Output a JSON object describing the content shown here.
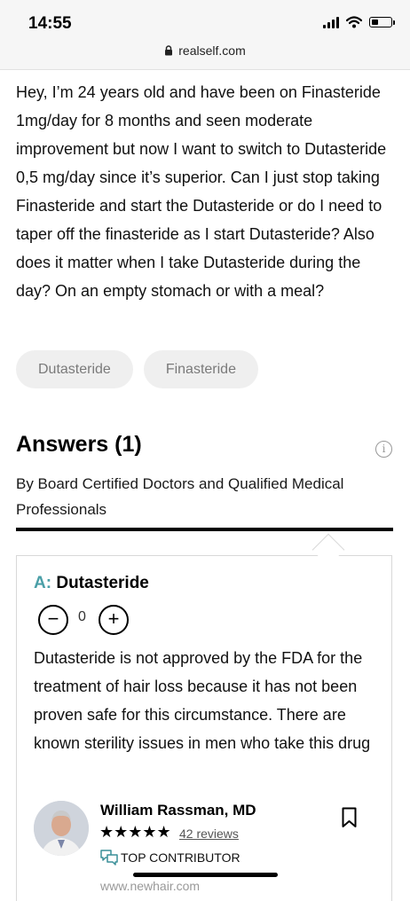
{
  "status_bar": {
    "time": "14:55",
    "battery_level_percent": 30
  },
  "browser": {
    "domain": "realself.com"
  },
  "question": {
    "body": "Hey, I’m 24 years old and have been on Finasteride 1mg/day for 8 months and seen moderate improvement but now I want to switch to Dutasteride 0,5 mg/day since it’s superior. Can I just stop taking Finasteride and start the Dutasteride or do I need to taper off the finasteride as I start Dutasteride? Also does it matter when I take Dutasteride during the day? On an empty stomach or with a meal?",
    "tags": [
      "Dutasteride",
      "Finasteride"
    ]
  },
  "answers": {
    "title": "Answers (1)",
    "subtitle": "By Board Certified Doctors and Qualified Medical Professionals"
  },
  "answer": {
    "prefix": "A:",
    "title": "Dutasteride",
    "vote_down": "−",
    "vote_count": "0",
    "vote_up": "+",
    "body": "Dutasteride is not approved by the FDA for the treatment of hair loss because it has not been proven safe for this circumstance. There are known sterility issues in men who take this drug"
  },
  "doctor": {
    "name": "William Rassman, MD",
    "stars": "★★★★★",
    "rating": 5,
    "reviews": "42 reviews",
    "badge": "TOP CONTRIBUTOR",
    "website_partial": "www.newhair.com"
  },
  "colors": {
    "accent": "#4a9fa7",
    "tag_bg": "#efefef"
  }
}
